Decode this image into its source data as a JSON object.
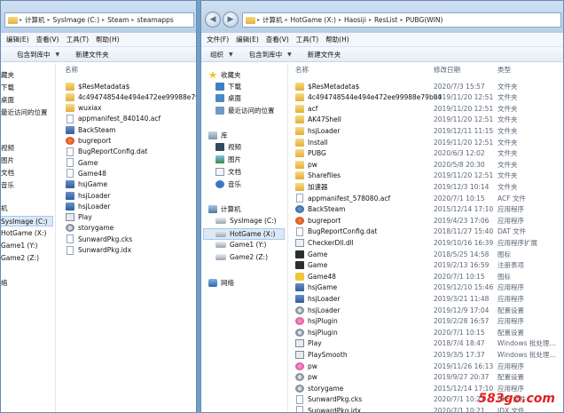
{
  "left_window": {
    "breadcrumb": [
      "计算机",
      "SysImage (C:)",
      "Steam",
      "steamapps"
    ],
    "menu": [
      "编辑(E)",
      "查看(V)",
      "工具(T)",
      "帮助(H)"
    ],
    "toolbar": {
      "include": "包含到库中",
      "new_folder": "新建文件夹"
    },
    "column_name": "名称",
    "nav": [
      "藏夹",
      "下载",
      "桌面",
      "最近访问的位置",
      "视频",
      "图片",
      "文档",
      "音乐",
      "机",
      "SysImage (C:)",
      "HotGame (X:)",
      "Game1 (Y:)",
      "Game2 (Z:)",
      "络"
    ],
    "files": [
      {
        "name": "$ResMetadata$",
        "icon": "folder"
      },
      {
        "name": "4c494748544e494e472ee99988e79bb4",
        "icon": "folder"
      },
      {
        "name": "wuxiax",
        "icon": "folder"
      },
      {
        "name": "appmanifest_840140.acf",
        "icon": "file"
      },
      {
        "name": "BackSteam",
        "icon": "exe"
      },
      {
        "name": "bugreport",
        "icon": "red"
      },
      {
        "name": "BugReportConfig.dat",
        "icon": "file"
      },
      {
        "name": "Game",
        "icon": "file"
      },
      {
        "name": "Game48",
        "icon": "file"
      },
      {
        "name": "hsjGame",
        "icon": "exe"
      },
      {
        "name": "hsjLoader",
        "icon": "exe"
      },
      {
        "name": "hsjLoader",
        "icon": "exe"
      },
      {
        "name": "Play",
        "icon": "bat"
      },
      {
        "name": "storygame",
        "icon": "gear"
      },
      {
        "name": "SunwardPkg.cks",
        "icon": "file"
      },
      {
        "name": "SunwardPkg.idx",
        "icon": "file"
      }
    ]
  },
  "right_window": {
    "breadcrumb": [
      "计算机",
      "HotGame (X:)",
      "Haosiji",
      "ResList",
      "PUBG(WIN)"
    ],
    "menu": [
      "文件(F)",
      "编辑(E)",
      "查看(V)",
      "工具(T)",
      "帮助(H)"
    ],
    "toolbar": {
      "organize": "组织",
      "include": "包含到库中",
      "new_folder": "新建文件夹"
    },
    "columns": {
      "name": "名称",
      "date": "修改日期",
      "type": "类型"
    },
    "nav": [
      "收藏夹",
      "下载",
      "桌面",
      "最近访问的位置",
      "库",
      "视频",
      "图片",
      "文档",
      "音乐",
      "计算机",
      "SysImage (C:)",
      "HotGame (X:)",
      "Game1 (Y:)",
      "Game2 (Z:)",
      "网络"
    ],
    "files": [
      {
        "name": "$ResMetadata$",
        "date": "2020/7/3 15:57",
        "type": "文件夹",
        "icon": "folder"
      },
      {
        "name": "4c494748544e494e472ee99988e79bb4",
        "date": "2019/11/20 12:51",
        "type": "文件夹",
        "icon": "folder"
      },
      {
        "name": "acf",
        "date": "2019/11/20 12:51",
        "type": "文件夹",
        "icon": "folder"
      },
      {
        "name": "AK47Shell",
        "date": "2019/11/20 12:51",
        "type": "文件夹",
        "icon": "folder"
      },
      {
        "name": "hsjLoader",
        "date": "2019/12/11 11:15",
        "type": "文件夹",
        "icon": "folder"
      },
      {
        "name": "Install",
        "date": "2019/11/20 12:51",
        "type": "文件夹",
        "icon": "folder"
      },
      {
        "name": "PUBG",
        "date": "2020/6/3 12:02",
        "type": "文件夹",
        "icon": "folder"
      },
      {
        "name": "pw",
        "date": "2020/5/8 20:30",
        "type": "文件夹",
        "icon": "folder"
      },
      {
        "name": "Sharefiles",
        "date": "2019/11/20 12:51",
        "type": "文件夹",
        "icon": "folder"
      },
      {
        "name": "加速器",
        "date": "2019/12/3 10:14",
        "type": "文件夹",
        "icon": "folder"
      },
      {
        "name": "appmanifest_578080.acf",
        "date": "2020/7/1 10:15",
        "type": "ACF 文件",
        "icon": "file"
      },
      {
        "name": "BackSteam",
        "date": "2015/12/14 17:10",
        "type": "应用程序",
        "icon": "steam"
      },
      {
        "name": "bugreport",
        "date": "2019/4/23 17:06",
        "type": "应用程序",
        "icon": "red"
      },
      {
        "name": "BugReportConfig.dat",
        "date": "2018/11/27 15:40",
        "type": "DAT 文件",
        "icon": "file"
      },
      {
        "name": "CheckerDll.dll",
        "date": "2019/10/16 16:39",
        "type": "应用程序扩展",
        "icon": "dll"
      },
      {
        "name": "Game",
        "date": "2018/5/25 14:58",
        "type": "图标",
        "icon": "game"
      },
      {
        "name": "Game",
        "date": "2019/2/13 16:59",
        "type": "注册表项",
        "icon": "game"
      },
      {
        "name": "Game48",
        "date": "2020/7/1 10:15",
        "type": "图标",
        "icon": "star"
      },
      {
        "name": "hsjGame",
        "date": "2019/12/10 15:46",
        "type": "应用程序",
        "icon": "exe"
      },
      {
        "name": "hsjLoader",
        "date": "2019/3/21 11:48",
        "type": "应用程序",
        "icon": "exe"
      },
      {
        "name": "hsjLoader",
        "date": "2019/12/9 17:04",
        "type": "配置设置",
        "icon": "gear"
      },
      {
        "name": "hsjPlugin",
        "date": "2019/2/28 16:57",
        "type": "应用程序",
        "icon": "pink"
      },
      {
        "name": "hsjPlugin",
        "date": "2020/7/1 10:15",
        "type": "配置设置",
        "icon": "gear"
      },
      {
        "name": "Play",
        "date": "2018/7/4 18:47",
        "type": "Windows 批处理...",
        "icon": "bat"
      },
      {
        "name": "PlaySmooth",
        "date": "2019/3/5 17:37",
        "type": "Windows 批处理...",
        "icon": "bat"
      },
      {
        "name": "pw",
        "date": "2019/11/26 16:13",
        "type": "应用程序",
        "icon": "pink"
      },
      {
        "name": "pw",
        "date": "2019/9/27 20:37",
        "type": "配置设置",
        "icon": "gear"
      },
      {
        "name": "storygame",
        "date": "2015/12/14 17:10",
        "type": "应用程序",
        "icon": "gear"
      },
      {
        "name": "SunwardPkg.cks",
        "date": "2020/7/1 10:21",
        "type": "CKS 文件",
        "icon": "file"
      },
      {
        "name": "SunwardPkg.idx",
        "date": "2020/7/1 10:21",
        "type": "IDX 文件",
        "icon": "file"
      }
    ]
  },
  "watermark": "583go.com"
}
